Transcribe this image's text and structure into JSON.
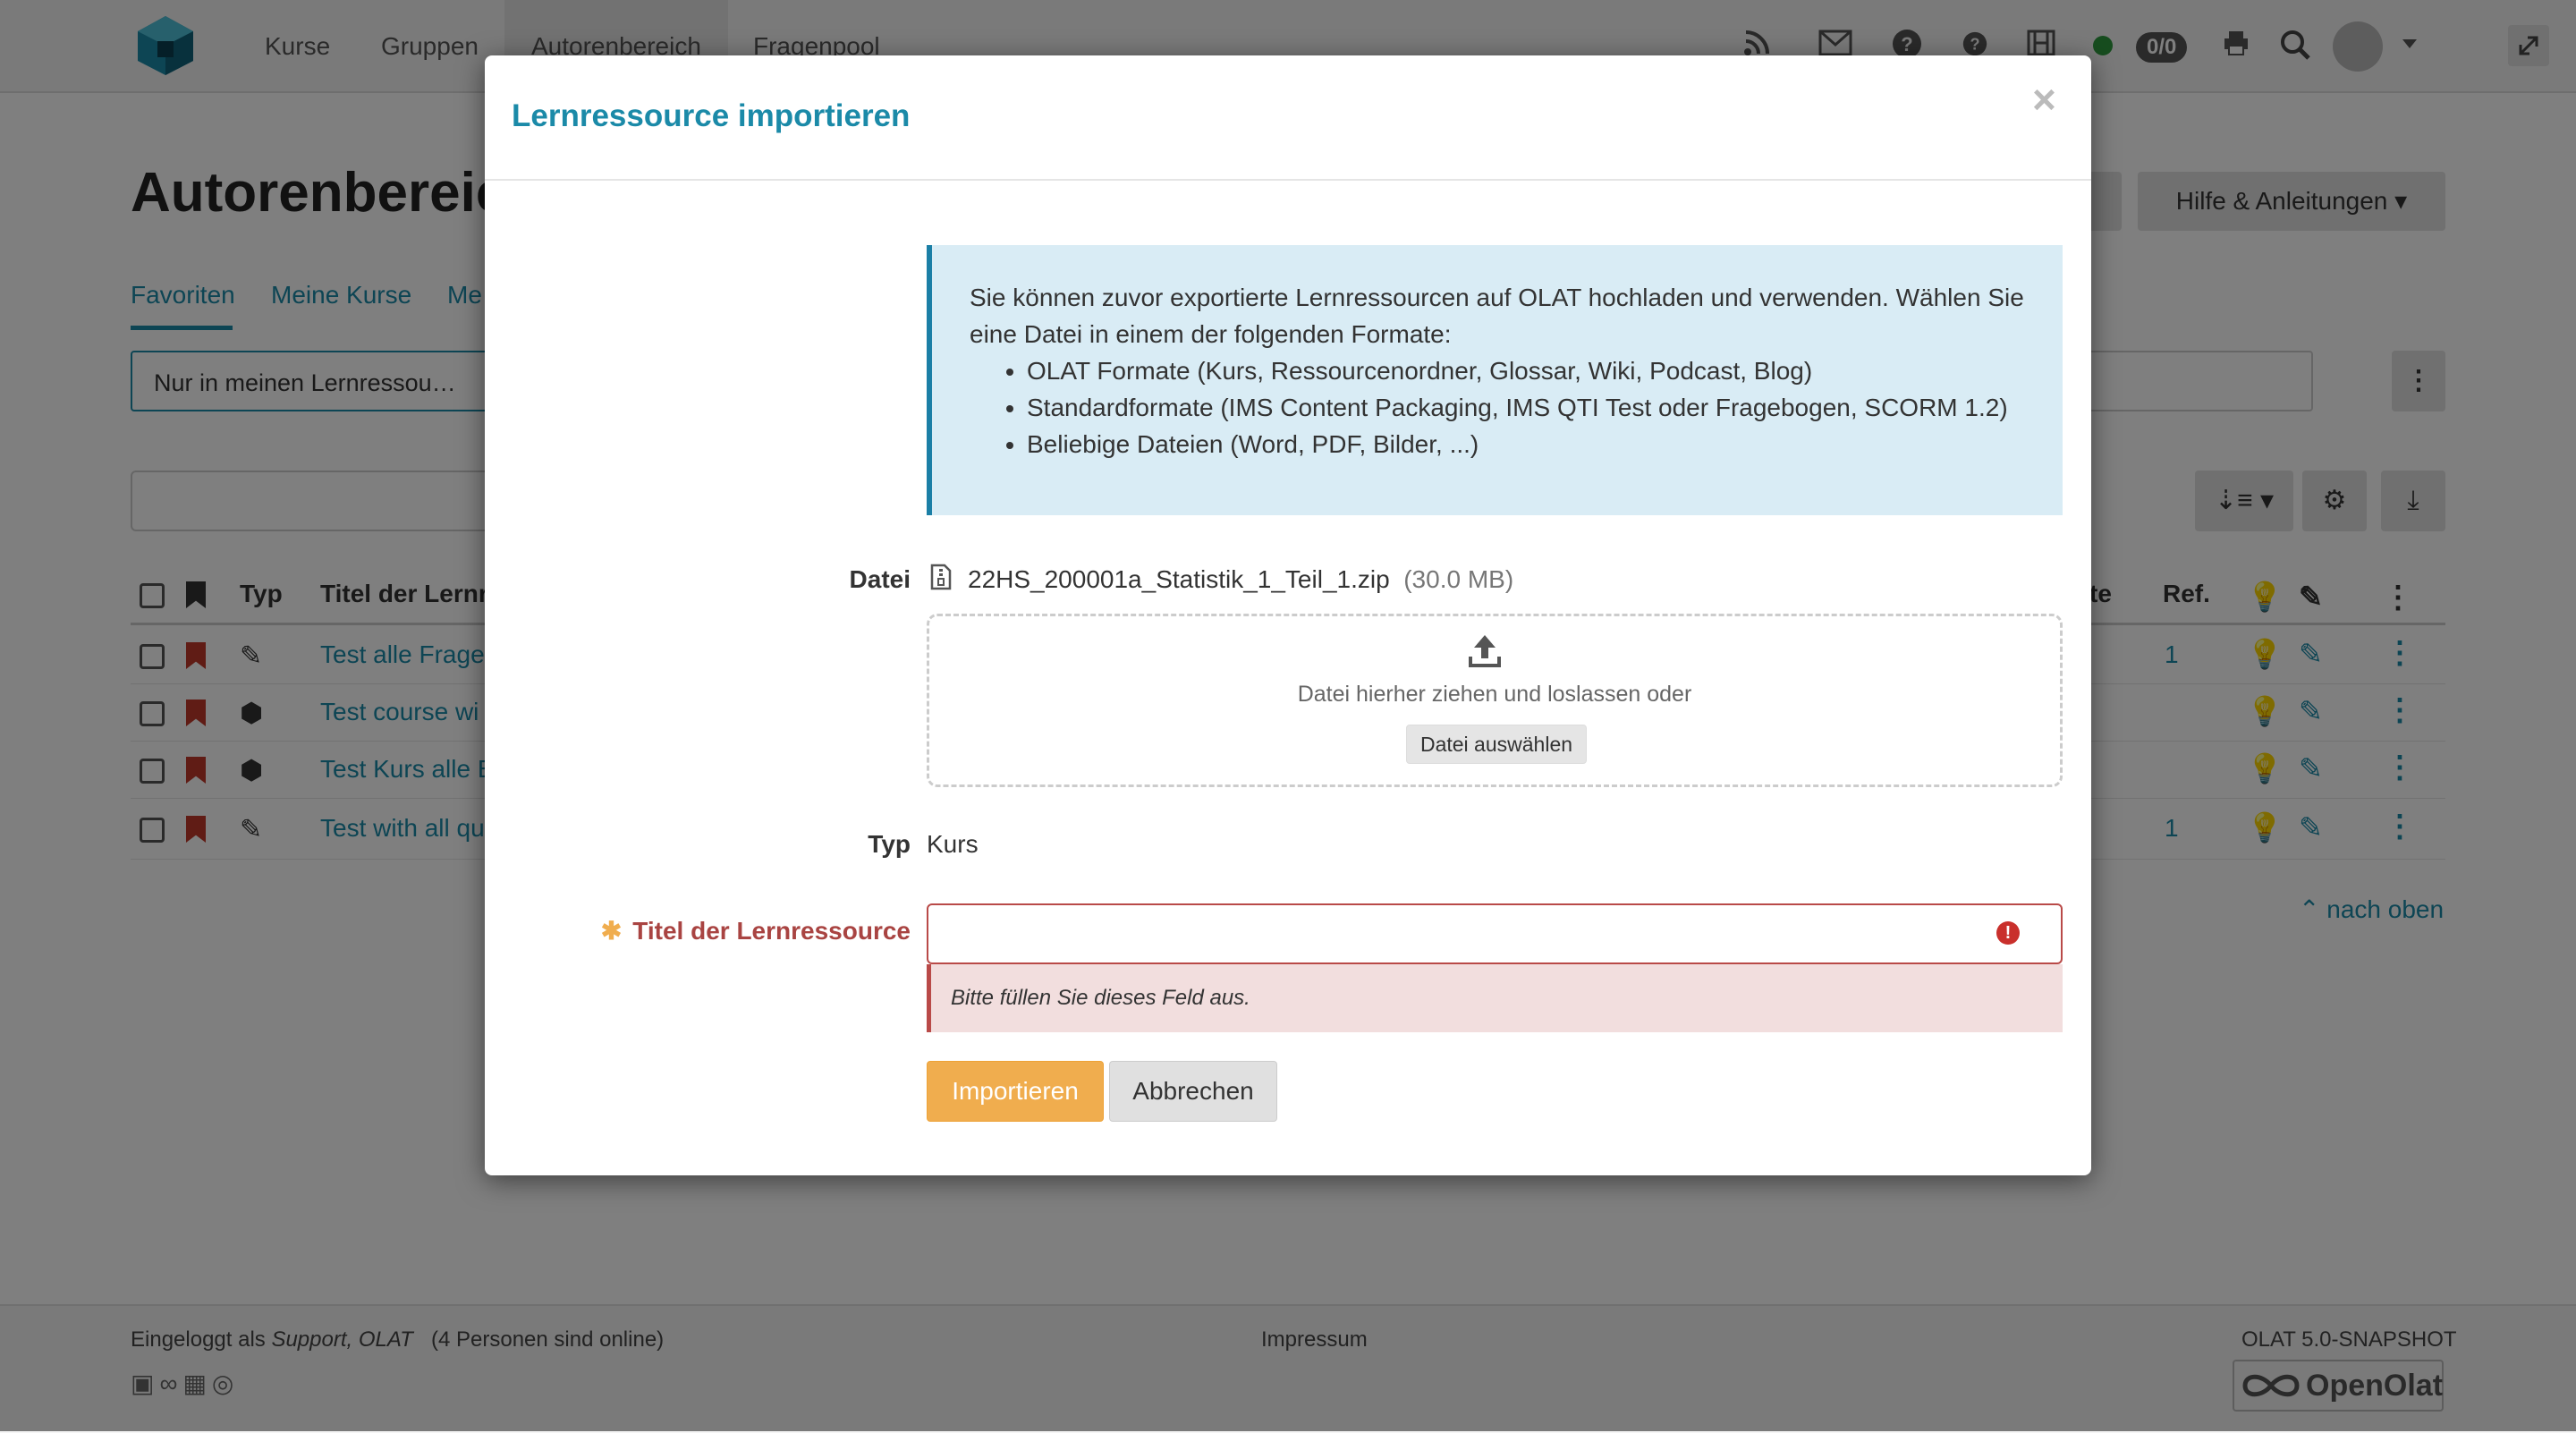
{
  "nav": {
    "items": [
      {
        "label": "Kurse"
      },
      {
        "label": "Gruppen"
      },
      {
        "label": "Autorenbereich"
      },
      {
        "label": "Fragenpool"
      }
    ],
    "badge": "0/0",
    "icons": [
      "rss-icon",
      "mail-icon",
      "help-icon",
      "help-icon-2",
      "film-icon",
      "online-status-icon",
      "print-icon",
      "search-icon",
      "avatar",
      "fullscreen-icon"
    ]
  },
  "page": {
    "title": "Autorenbereich",
    "tabs": [
      "Favoriten",
      "Meine Kurse",
      "Me"
    ],
    "filter": "Nur in meinen Lernressou…",
    "help_button": "Hilfe & Anleitungen",
    "table": {
      "columns": [
        "Typ",
        "Titel der Lernr",
        "te",
        "Ref."
      ],
      "rows": [
        {
          "title": "Test alle Frage",
          "type_icon": "edit-icon",
          "ref": "1"
        },
        {
          "title": "Test course wi",
          "type_icon": "cube-icon",
          "ref": ""
        },
        {
          "title": "Test Kurs alle E",
          "type_icon": "cube-icon",
          "ref": ""
        },
        {
          "title": "Test with all qu",
          "type_icon": "edit-icon",
          "ref": "1"
        }
      ]
    },
    "back_to_top": "nach oben"
  },
  "footer": {
    "logged_in_prefix": "Eingeloggt als ",
    "user": "Support, OLAT",
    "online": "(4 Personen sind online)",
    "impressum": "Impressum",
    "version": "OLAT 5.0-SNAPSHOT",
    "logo_text": "OpenOlat"
  },
  "modal": {
    "title": "Lernressource importieren",
    "close": "×",
    "info_intro": "Sie können zuvor exportierte Lernressourcen auf OLAT hochladen und verwenden. Wählen Sie eine Datei in einem der folgenden Formate:",
    "info_items": [
      "OLAT Formate (Kurs, Ressourcenordner, Glossar, Wiki, Podcast, Blog)",
      "Standardformate (IMS Content Packaging, IMS QTI Test oder Fragebogen, SCORM 1.2)",
      "Beliebige Dateien (Word, PDF, Bilder, ...)"
    ],
    "file_label": "Datei",
    "file_name": "22HS_200001a_Statistik_1_Teil_1.zip",
    "file_size": "(30.0 MB)",
    "drop_text": "Datei hierher ziehen und loslassen oder",
    "choose_button": "Datei auswählen",
    "type_label": "Typ",
    "type_value": "Kurs",
    "title_label": "Titel der Lernressource",
    "title_value": "",
    "error_message": "Bitte füllen Sie dieses Feld aus.",
    "import_button": "Importieren",
    "cancel_button": "Abbrechen"
  }
}
